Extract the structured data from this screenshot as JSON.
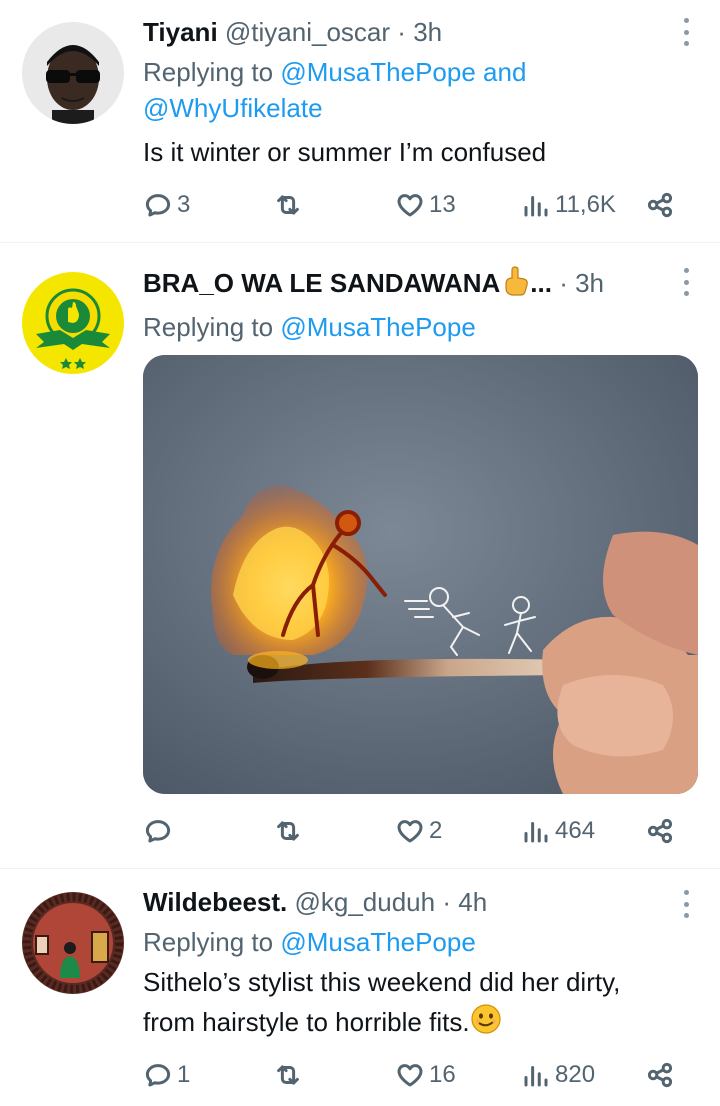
{
  "tweets": [
    {
      "name": "Tiyani",
      "handle": "@tiyani_oscar",
      "separator": "·",
      "time": "3h",
      "replying_prefix": "Replying to",
      "mention_1": "@MusaThePope",
      "joiner": "and",
      "mention_2": "@WhyUfikelate",
      "text": "Is it winter or summer I’m confused",
      "replies": "3",
      "retweets": "",
      "likes": "13",
      "views": "11,6K"
    },
    {
      "name": "BRA_O WA LE SANDAWANA",
      "name_suffix": "...",
      "handle": "",
      "separator": "·",
      "time": "3h",
      "replying_prefix": "Replying to",
      "mention_1": "@MusaThePope",
      "replies": "",
      "retweets": "",
      "likes": "2",
      "views": "464"
    },
    {
      "name": "Wildebeest.",
      "handle": "@kg_duduh",
      "separator": "·",
      "time": "4h",
      "replying_prefix": "Replying to",
      "mention_1": "@MusaThePope",
      "text_line_1": "Sithelo’s stylist this weekend did her dirty,",
      "text_line_2": "from hairstyle to horrible fits.",
      "replies": "1",
      "retweets": "",
      "likes": "16",
      "views": "820"
    }
  ],
  "icons": {
    "reply": "reply-icon",
    "retweet": "retweet-icon",
    "like": "heart-icon",
    "views": "views-icon",
    "share": "share-icon",
    "more": "more-icon",
    "pointing_emoji": "pointing-hand-emoji",
    "smile_emoji": "smiling-face-emoji"
  },
  "colors": {
    "text": "#0f1419",
    "muted": "#536471",
    "link": "#1d9bf0",
    "divider": "#eff3f4"
  }
}
